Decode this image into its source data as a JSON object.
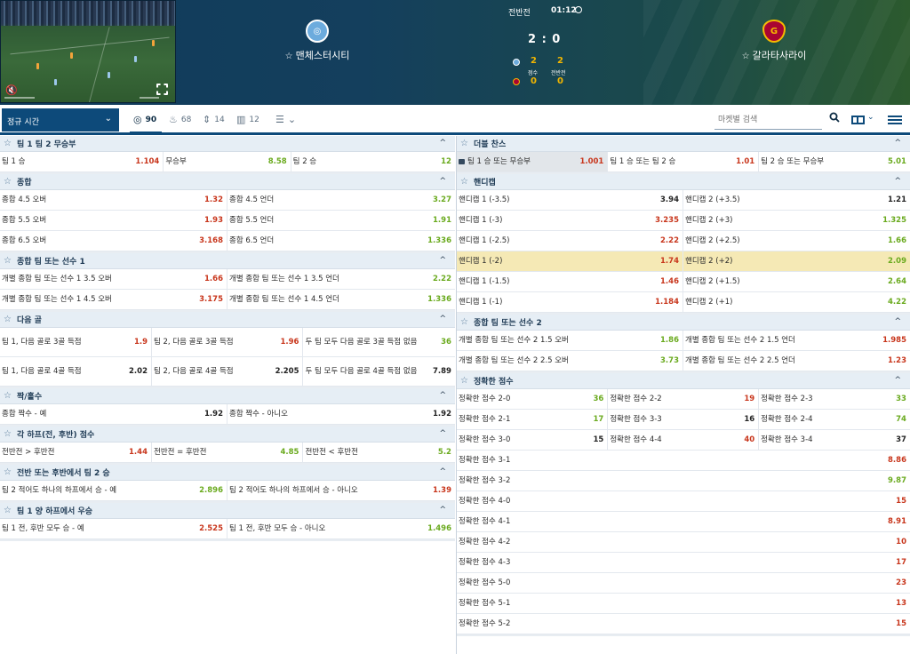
{
  "match": {
    "period": "전반전",
    "clock": "01:12",
    "score": "2 : 0",
    "home": {
      "name": "맨체스터시티",
      "color": "#6cabdd"
    },
    "away": {
      "name": "갈라타사라이",
      "color": "#a90432"
    },
    "home_stats": [
      "2",
      "2"
    ],
    "away_stats": [
      "0",
      "0"
    ],
    "stat_labels": [
      "점수",
      "전반전"
    ]
  },
  "toolbar": {
    "period_select": "정규 시간",
    "filters": [
      {
        "icon": "target-icon",
        "count": "90"
      },
      {
        "icon": "fire-icon",
        "count": "68"
      },
      {
        "icon": "swap-icon",
        "count": "14"
      },
      {
        "icon": "bars-icon",
        "count": "12"
      }
    ],
    "search_placeholder": "마켓별 검색"
  },
  "colors": {
    "accent": "#0d4a7a",
    "odd_up": "#6aaa1e",
    "odd_down": "#c8361c",
    "highlight": "#f5e9b5"
  },
  "left_markets": [
    {
      "title": "팀 1 팀 2 무승부",
      "cols": [
        36,
        28,
        36
      ],
      "rows": [
        [
          [
            "팀 1 승",
            "1.104",
            "down"
          ],
          [
            "무승부",
            "8.58",
            "up"
          ],
          [
            "팀 2 승",
            "12",
            "up"
          ]
        ]
      ]
    },
    {
      "title": "종합",
      "cols": [
        50,
        50
      ],
      "rows": [
        [
          [
            "종합 4.5 오버",
            "1.32",
            "down"
          ],
          [
            "종합 4.5 언더",
            "3.27",
            "up"
          ]
        ],
        [
          [
            "종합 5.5 오버",
            "1.93",
            "down"
          ],
          [
            "종합 5.5 언더",
            "1.91",
            "up"
          ]
        ],
        [
          [
            "종합 6.5 오버",
            "3.168",
            "down"
          ],
          [
            "종합 6.5 언더",
            "1.336",
            "up"
          ]
        ]
      ]
    },
    {
      "title": "종합 팀 또는 선수 1",
      "cols": [
        50,
        50
      ],
      "rows": [
        [
          [
            "개별 종합 팀 또는 선수 1 3.5 오버",
            "1.66",
            "down"
          ],
          [
            "개별 종합 팀 또는 선수 1 3.5 언더",
            "2.22",
            "up"
          ]
        ],
        [
          [
            "개별 종합 팀 또는 선수 1 4.5 오버",
            "3.175",
            "down"
          ],
          [
            "개별 종합 팀 또는 선수 1 4.5 언더",
            "1.336",
            "up"
          ]
        ]
      ]
    },
    {
      "title": "다음 골",
      "cols": [
        33.4,
        33.3,
        33.3
      ],
      "tall": true,
      "rows": [
        [
          [
            "팀 1, 다음 골로 3골 득점",
            "1.9",
            "down"
          ],
          [
            "팀 2, 다음 골로 3골 득점",
            "1.96",
            "down"
          ],
          [
            "두 팀 모두 다음 골로 3골 득점 없음",
            "36",
            "up"
          ]
        ],
        [
          [
            "팀 1, 다음 골로 4골 득점",
            "2.02",
            ""
          ],
          [
            "팀 2, 다음 골로 4골 득점",
            "2.205",
            ""
          ],
          [
            "두 팀 모두 다음 골로 4골 득점 없음",
            "7.89",
            ""
          ]
        ]
      ]
    },
    {
      "title": "짝/홀수",
      "cols": [
        50,
        50
      ],
      "rows": [
        [
          [
            "종합 짝수 - 예",
            "1.92",
            ""
          ],
          [
            "종합 짝수 - 아니오",
            "1.92",
            ""
          ]
        ]
      ]
    },
    {
      "title": "각 하프(전, 후반) 점수",
      "cols": [
        33.4,
        33.3,
        33.3
      ],
      "rows": [
        [
          [
            "전반전 > 후반전",
            "1.44",
            "down"
          ],
          [
            "전반전 = 후반전",
            "4.85",
            "up"
          ],
          [
            "전반전 < 후반전",
            "5.2",
            "up"
          ]
        ]
      ]
    },
    {
      "title": "전반 또는 후반에서 팀 2 승",
      "cols": [
        50,
        50
      ],
      "rows": [
        [
          [
            "팀 2 적어도 하나의 하프에서 승 - 예",
            "2.896",
            "up"
          ],
          [
            "팀 2 적어도 하나의 하프에서 승 - 아니오",
            "1.39",
            "down"
          ]
        ]
      ]
    },
    {
      "title": "팀 1 양 하프에서 우승",
      "cols": [
        50,
        50
      ],
      "rows": [
        [
          [
            "팀 1 전, 후반 모두 승 - 예",
            "2.525",
            "down"
          ],
          [
            "팀 1 전, 후반 모두 승 - 아니오",
            "1.496",
            "up"
          ]
        ]
      ]
    }
  ],
  "right_markets": [
    {
      "title": "더블 찬스",
      "cols": [
        33.4,
        33.3,
        33.3
      ],
      "rows": [
        [
          [
            "팀 1 승 또는 무승부",
            "1.001",
            "down",
            "locked"
          ],
          [
            "팀 1 승 또는 팀 2 승",
            "1.01",
            "down"
          ],
          [
            "팀 2 승 또는 무승부",
            "5.01",
            "up"
          ]
        ]
      ]
    },
    {
      "title": "핸디캡",
      "cols": [
        50,
        50
      ],
      "rows": [
        [
          [
            "핸디캡 1 (-3.5)",
            "3.94",
            ""
          ],
          [
            "핸디캡 2 (+3.5)",
            "1.21",
            ""
          ]
        ],
        [
          [
            "핸디캡 1 (-3)",
            "3.235",
            "down"
          ],
          [
            "핸디캡 2 (+3)",
            "1.325",
            "up"
          ]
        ],
        [
          [
            "핸디캡 1 (-2.5)",
            "2.22",
            "down"
          ],
          [
            "핸디캡 2 (+2.5)",
            "1.66",
            "up"
          ]
        ],
        [
          [
            "핸디캡 1 (-2)",
            "1.74",
            "down",
            "hl"
          ],
          [
            "핸디캡 2 (+2)",
            "2.09",
            "up",
            "hl"
          ]
        ],
        [
          [
            "핸디캡 1 (-1.5)",
            "1.46",
            "down"
          ],
          [
            "핸디캡 2 (+1.5)",
            "2.64",
            "up"
          ]
        ],
        [
          [
            "핸디캡 1 (-1)",
            "1.184",
            "down"
          ],
          [
            "핸디캡 2 (+1)",
            "4.22",
            "up"
          ]
        ]
      ]
    },
    {
      "title": "종합 팀 또는 선수 2",
      "cols": [
        50,
        50
      ],
      "rows": [
        [
          [
            "개별 종합 팀 또는 선수 2 1.5 오버",
            "1.86",
            "up"
          ],
          [
            "개별 종합 팀 또는 선수 2 1.5 언더",
            "1.985",
            "down"
          ]
        ],
        [
          [
            "개별 종합 팀 또는 선수 2 2.5 오버",
            "3.73",
            "up"
          ],
          [
            "개별 종합 팀 또는 선수 2 2.5 언더",
            "1.23",
            "down"
          ]
        ]
      ]
    },
    {
      "title": "정확한 점수",
      "cols": [
        33.4,
        33.3,
        33.3
      ],
      "rows": [
        [
          [
            "정확한 점수 2-0",
            "36",
            "up"
          ],
          [
            "정확한 점수 2-2",
            "19",
            "down"
          ],
          [
            "정확한 점수 2-3",
            "33",
            "up"
          ]
        ],
        [
          [
            "정확한 점수 2-1",
            "17",
            "up"
          ],
          [
            "정확한 점수 3-3",
            "16",
            ""
          ],
          [
            "정확한 점수 2-4",
            "74",
            "up"
          ]
        ],
        [
          [
            "정확한 점수 3-0",
            "15",
            ""
          ],
          [
            "정확한 점수 4-4",
            "40",
            "down"
          ],
          [
            "정확한 점수 3-4",
            "37",
            ""
          ]
        ],
        [
          [
            "정확한 점수 3-1",
            "8.86",
            "down"
          ]
        ],
        [
          [
            "정확한 점수 3-2",
            "9.87",
            "up"
          ]
        ],
        [
          [
            "정확한 점수 4-0",
            "15",
            "down"
          ]
        ],
        [
          [
            "정확한 점수 4-1",
            "8.91",
            "down"
          ]
        ],
        [
          [
            "정확한 점수 4-2",
            "10",
            "down"
          ]
        ],
        [
          [
            "정확한 점수 4-3",
            "17",
            "down"
          ]
        ],
        [
          [
            "정확한 점수 5-0",
            "23",
            "down"
          ]
        ],
        [
          [
            "정확한 점수 5-1",
            "13",
            "down"
          ]
        ],
        [
          [
            "정확한 점수 5-2",
            "15",
            "down"
          ]
        ]
      ]
    }
  ]
}
